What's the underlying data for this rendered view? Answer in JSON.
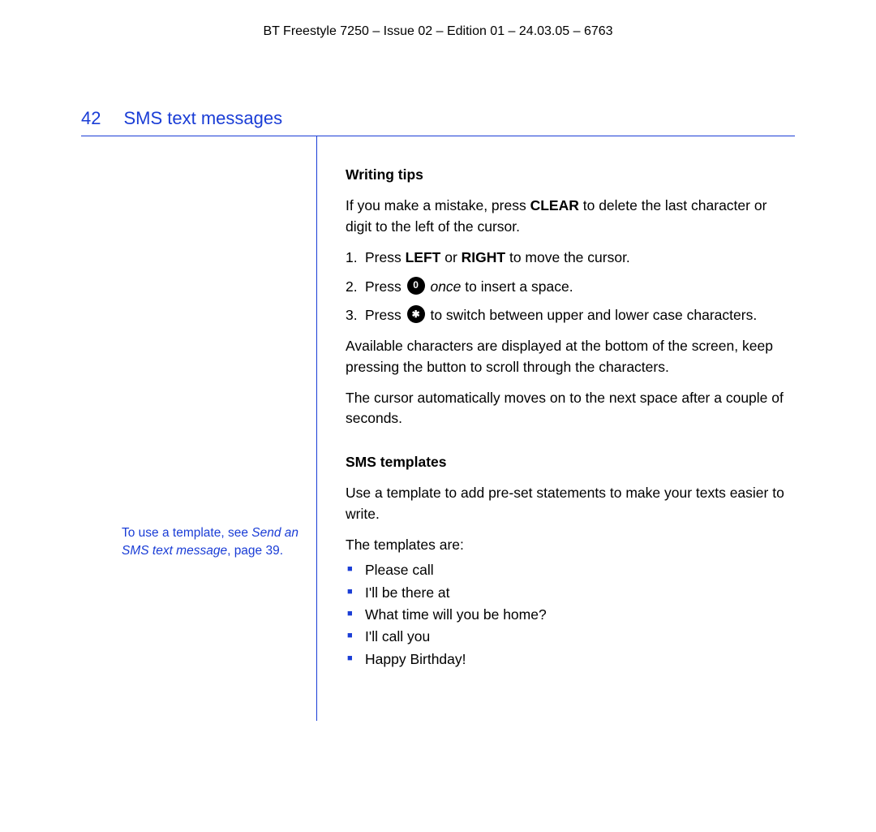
{
  "header": {
    "doc_line": "BT Freestyle 7250 – Issue 02 – Edition 01 – 24.03.05 – 6763"
  },
  "page": {
    "number": "42",
    "title": "SMS text messages"
  },
  "sidebar": {
    "note_prefix": "To use a template, see ",
    "note_italic": "Send an SMS text message",
    "note_suffix": ", page 39."
  },
  "sections": {
    "writing_tips": {
      "heading": "Writing tips",
      "intro_pre": "If you make a mistake, press ",
      "intro_bold": "CLEAR",
      "intro_post": " to delete the last character or digit to the left of the cursor.",
      "step1_pre": "Press ",
      "step1_b1": "LEFT",
      "step1_mid": " or ",
      "step1_b2": "RIGHT",
      "step1_post": " to move the cursor.",
      "step2_pre": "Press ",
      "step2_icon": "0",
      "step2_italic": " once",
      "step2_post": " to insert a space.",
      "step3_pre": "Press ",
      "step3_icon": "✱",
      "step3_post": " to switch between upper and lower case characters.",
      "para_avail": "Available characters are displayed at the bottom of the screen, keep pressing the button to scroll through the characters.",
      "para_cursor": "The cursor automatically moves on to the next space after a couple of seconds."
    },
    "sms_templates": {
      "heading": "SMS templates",
      "intro": "Use a template to add pre-set statements to make your texts easier to write.",
      "list_intro": "The templates are:",
      "items": [
        "Please call",
        "I'll be there at",
        "What time will you be home?",
        "I'll call you",
        "Happy Birthday!"
      ]
    }
  }
}
